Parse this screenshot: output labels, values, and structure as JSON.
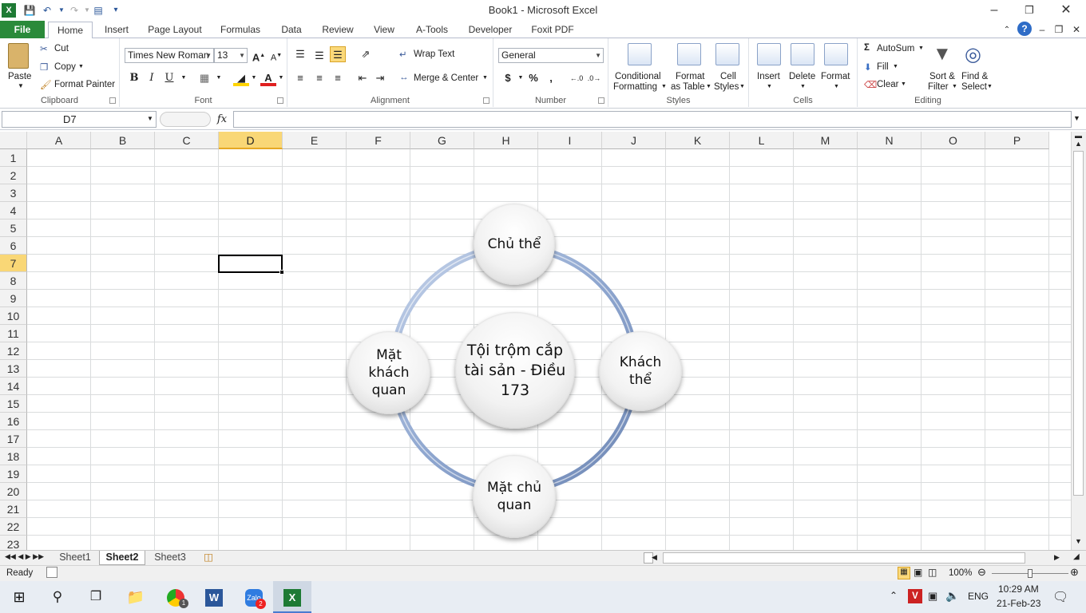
{
  "window": {
    "title": "Book1  -  Microsoft Excel"
  },
  "quick_access": {
    "excel_icon": "excel-logo-icon",
    "save": "save-icon",
    "undo": "undo-icon",
    "redo": "redo-icon"
  },
  "tabs": [
    {
      "label": "File"
    },
    {
      "label": "Home"
    },
    {
      "label": "Insert"
    },
    {
      "label": "Page Layout"
    },
    {
      "label": "Formulas"
    },
    {
      "label": "Data"
    },
    {
      "label": "Review"
    },
    {
      "label": "View"
    },
    {
      "label": "A-Tools"
    },
    {
      "label": "Developer"
    },
    {
      "label": "Foxit PDF"
    }
  ],
  "ribbon": {
    "clipboard": {
      "paste": "Paste",
      "cut": "Cut",
      "copy": "Copy",
      "format_painter": "Format Painter",
      "label": "Clipboard"
    },
    "font": {
      "name": "Times New Roman",
      "size": "13",
      "bold": "B",
      "italic": "I",
      "underline": "U",
      "label": "Font"
    },
    "alignment": {
      "wrap": "Wrap Text",
      "merge": "Merge & Center",
      "label": "Alignment"
    },
    "number": {
      "format": "General",
      "currency": "$",
      "percent": "%",
      "comma": ",",
      "label": "Number"
    },
    "styles": {
      "conditional": "Conditional",
      "conditional2": "Formatting",
      "format_table": "Format",
      "format_table2": "as Table",
      "cell_styles": "Cell",
      "cell_styles2": "Styles",
      "label": "Styles"
    },
    "cells": {
      "insert": "Insert",
      "delete": "Delete",
      "format": "Format",
      "label": "Cells"
    },
    "editing": {
      "autosum": "AutoSum",
      "fill": "Fill",
      "clear": "Clear",
      "sort": "Sort &",
      "sort2": "Filter",
      "find": "Find &",
      "find2": "Select",
      "label": "Editing"
    }
  },
  "formula_bar": {
    "name_box": "D7",
    "fx": "fx",
    "value": ""
  },
  "columns": [
    "A",
    "B",
    "C",
    "D",
    "E",
    "F",
    "G",
    "H",
    "I",
    "J",
    "K",
    "L",
    "M",
    "N",
    "O",
    "P"
  ],
  "rows": [
    "1",
    "2",
    "3",
    "4",
    "5",
    "6",
    "7",
    "8",
    "9",
    "10",
    "11",
    "12",
    "13",
    "14",
    "15",
    "16",
    "17",
    "18",
    "19",
    "20",
    "21",
    "22",
    "23"
  ],
  "selected": {
    "column": "D",
    "row": "7"
  },
  "smartart": {
    "center": "Tội trộm cắp tài sản - Điều 173",
    "nodes": [
      {
        "label": "Chủ thể"
      },
      {
        "label": "Khách thể"
      },
      {
        "label": "Mặt chủ quan"
      },
      {
        "label": "Mặt khách quan"
      }
    ]
  },
  "sheets": [
    {
      "name": "Sheet1"
    },
    {
      "name": "Sheet2",
      "active": true
    },
    {
      "name": "Sheet3"
    }
  ],
  "status": {
    "ready": "Ready",
    "zoom": "100%"
  },
  "taskbar": {
    "language": "ENG",
    "time": "10:29 AM",
    "date": "21-Feb-23",
    "chrome_badge": "1",
    "zalo_badge": "2"
  }
}
